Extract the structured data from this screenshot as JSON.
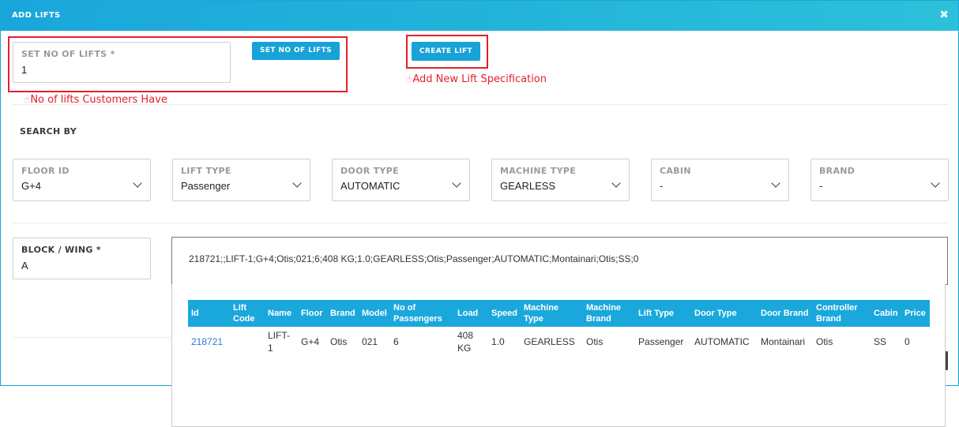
{
  "modal": {
    "title": "ADD LIFTS",
    "close_icon": "close-icon"
  },
  "set_lifts": {
    "label": "SET NO OF LIFTS *",
    "value": "1",
    "button_label": "SET NO OF LIFTS",
    "hint": "No of lifts Customers Have",
    "hint_icon": "pointing-hand-icon"
  },
  "create_lift": {
    "button_label": "CREATE LIFT",
    "hint": "Add New Lift Specification",
    "hint_icon": "pointing-hand-icon"
  },
  "search": {
    "title": "SEARCH BY",
    "filters": [
      {
        "label": "FLOOR ID",
        "value": "G+4"
      },
      {
        "label": "LIFT TYPE",
        "value": "Passenger"
      },
      {
        "label": "DOOR TYPE",
        "value": "AUTOMATIC"
      },
      {
        "label": "MACHINE TYPE",
        "value": "GEARLESS"
      },
      {
        "label": "CABIN",
        "value": "-"
      },
      {
        "label": "BRAND",
        "value": "-"
      }
    ]
  },
  "block_wing": {
    "label": "BLOCK / WING *",
    "value": "A"
  },
  "lift_search": {
    "value": "218721;;LIFT-1;G+4;Otis;021;6;408 KG;1.0;GEARLESS;Otis;Passenger;AUTOMATIC;Montainari;Otis;SS;0"
  },
  "results_table": {
    "columns": [
      "Id",
      "Lift Code",
      "Name",
      "Floor",
      "Brand",
      "Model",
      "No of Passengers",
      "Load",
      "Speed",
      "Machine Type",
      "Machine Brand",
      "Lift Type",
      "Door Type",
      "Door Brand",
      "Controller Brand",
      "Cabin",
      "Price"
    ],
    "rows": [
      [
        "218721",
        "",
        "LIFT-1",
        "G+4",
        "Otis",
        "021",
        "6",
        "408 KG",
        "1.0",
        "GEARLESS",
        "Otis",
        "Passenger",
        "AUTOMATIC",
        "Montainari",
        "Otis",
        "SS",
        "0"
      ]
    ]
  },
  "colors": {
    "header": "#1aa6db",
    "accent_button": "#17a2d8",
    "annotation_red": "#e2202b",
    "link": "#2a7ad6"
  }
}
